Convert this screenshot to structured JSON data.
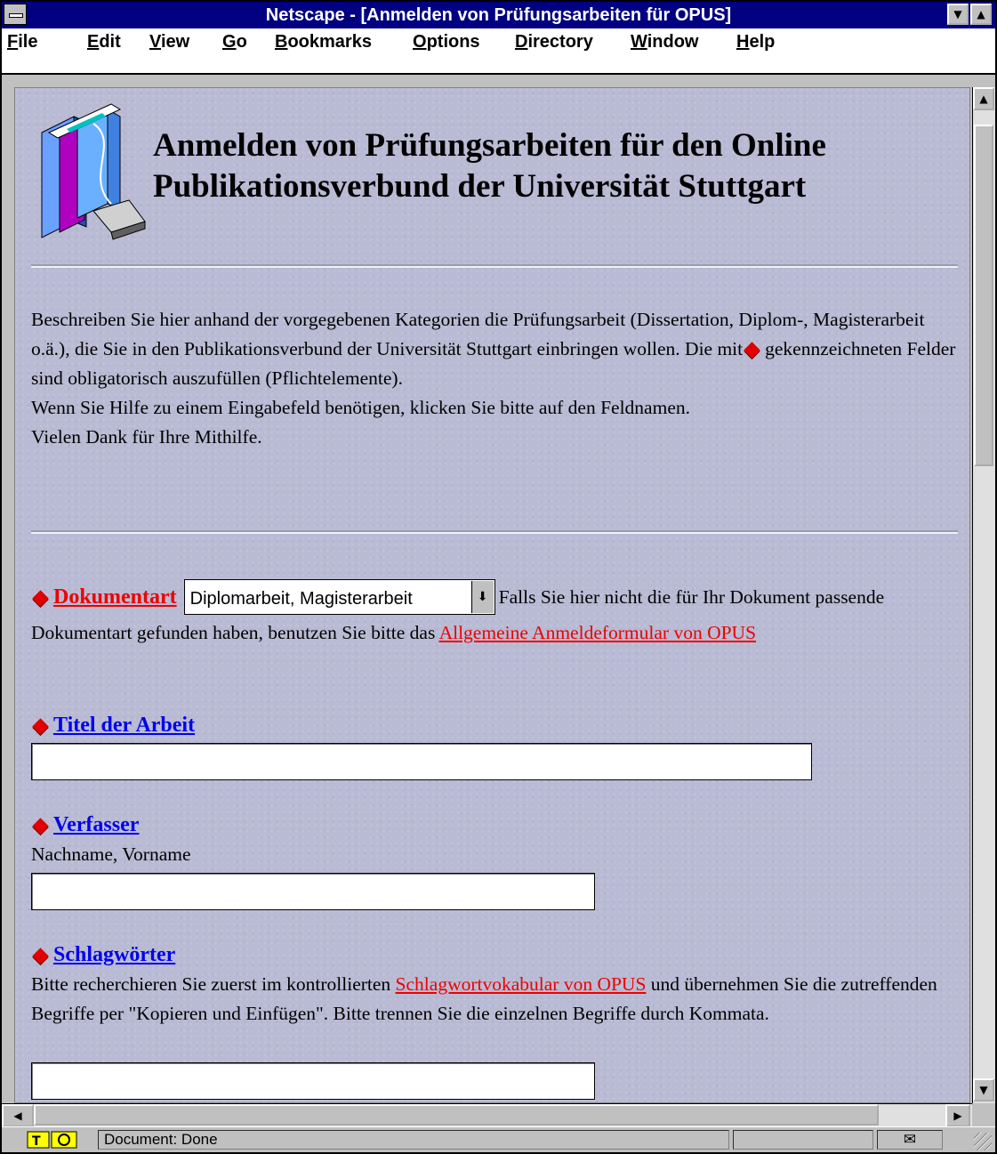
{
  "window": {
    "title": "Netscape - [Anmelden von Prüfungsarbeiten für OPUS]",
    "minimize_glyph": "▼",
    "maximize_glyph": "▲"
  },
  "menu": {
    "file": {
      "u": "F",
      "rest": "ile"
    },
    "edit": {
      "u": "E",
      "rest": "dit"
    },
    "view": {
      "u": "V",
      "rest": "iew"
    },
    "go": {
      "u": "G",
      "rest": "o"
    },
    "bookmarks": {
      "u": "B",
      "rest": "ookmarks"
    },
    "options": {
      "u": "O",
      "rest": "ptions"
    },
    "directory": {
      "u": "D",
      "rest": "irectory"
    },
    "window": {
      "u": "W",
      "rest": "indow"
    },
    "help": {
      "u": "H",
      "rest": "elp"
    }
  },
  "page": {
    "title_line1": "Anmelden von Prüfungsarbeiten für den Online",
    "title_line2": "Publikationsverbund der Universität Stuttgart",
    "intro_part1": "Beschreiben Sie hier anhand der vorgegebenen Kategorien die Prüfungsarbeit (Dissertation, Diplom-, Magisterarbeit o.ä.), die Sie in den Publikationsverbund der Universität Stuttgart einbringen wollen. Die mit",
    "intro_part2": "gekennzeichneten Felder sind obligatorisch auszufüllen (Pflichtelemente).",
    "intro_help": "Wenn Sie Hilfe zu einem Eingabefeld benötigen, klicken Sie bitte auf den Feldnamen.",
    "intro_thanks": "Vielen Dank für Ihre Mithilfe."
  },
  "form": {
    "dokumentart": {
      "label": "Dokumentart",
      "selected": "Diplomarbeit, Magisterarbeit",
      "arrow_glyph": "⬇",
      "note_before": "Falls Sie hier nicht die für Ihr Dokument passende Dokumentart gefunden haben, benutzen Sie bitte das",
      "link": "Allgemeine Anmeldeformular von OPUS"
    },
    "titel": {
      "label": "Titel der Arbeit",
      "value": ""
    },
    "verfasser": {
      "label": "Verfasser",
      "hint": "Nachname, Vorname",
      "value": ""
    },
    "schlagwoerter": {
      "label": "Schlagwörter",
      "hint_before": "Bitte recherchieren Sie zuerst im kontrollierten",
      "hint_link": "Schlagwortvokabular von OPUS",
      "hint_after": "und übernehmen Sie die zutreffenden Begriffe per \"Kopieren und Einfügen\". Bitte trennen Sie die einzelnen Begriffe durch Kommata.",
      "value": ""
    }
  },
  "scrollbars": {
    "up": "▲",
    "down": "▼",
    "left": "◀",
    "right": "▶"
  },
  "status": {
    "text": "Document: Done",
    "mail_glyph": "✉"
  },
  "colors": {
    "background": "#b9bad3",
    "titlebar": "#000080",
    "required_marker": "#e00000",
    "link_blue": "#0000ee",
    "link_red": "#ee0000"
  }
}
